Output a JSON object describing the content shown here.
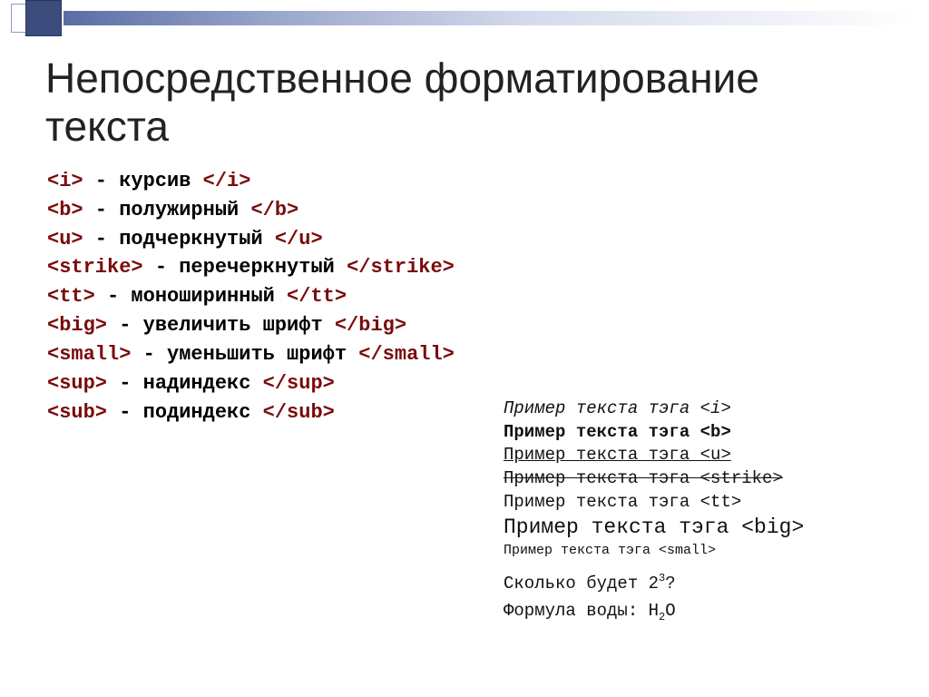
{
  "header": {
    "title": "Непосредственное форматирование текста"
  },
  "tags": [
    {
      "open": "<i>",
      "desc": " - курсив ",
      "close": "</i>"
    },
    {
      "open": "<b>",
      "desc": " - полужирный ",
      "close": "</b>"
    },
    {
      "open": "<u>",
      "desc": " - подчеркнутый ",
      "close": "</u>"
    },
    {
      "open": "<strike>",
      "desc": " - перечеркнутый ",
      "close": "</strike>"
    },
    {
      "open": "<tt>",
      "desc": " - моноширинный ",
      "close": "</tt>"
    },
    {
      "open": "<big>",
      "desc": " - увеличить шрифт ",
      "close": "</big>"
    },
    {
      "open": "<small>",
      "desc": " - уменьшить шрифт ",
      "close": "</small>"
    },
    {
      "open": "<sup>",
      "desc": " - надиндекс ",
      "close": "</sup>"
    },
    {
      "open": "<sub>",
      "desc": " - подиндекс ",
      "close": "</sub>"
    }
  ],
  "examples": [
    {
      "text": "Пример текста тэга <i>",
      "cls": "ex-i"
    },
    {
      "text": "Пример текста тэга <b>",
      "cls": "ex-b"
    },
    {
      "text": "Пример текста тэга <u>",
      "cls": "ex-u"
    },
    {
      "text": "Пример текста тэга <strike>",
      "cls": "ex-strike"
    },
    {
      "text": "Пример текста тэга <tt>",
      "cls": ""
    },
    {
      "text": "Пример текста тэга <big>",
      "cls": "ex-big"
    },
    {
      "text": "Пример текста тэга <small>",
      "cls": "ex-small"
    }
  ],
  "qa": {
    "line1_pre": "Сколько будет 2",
    "line1_sup": "3",
    "line1_post": "?",
    "line2_pre": "Формула воды: H",
    "line2_sub": "2",
    "line2_post": "O"
  }
}
